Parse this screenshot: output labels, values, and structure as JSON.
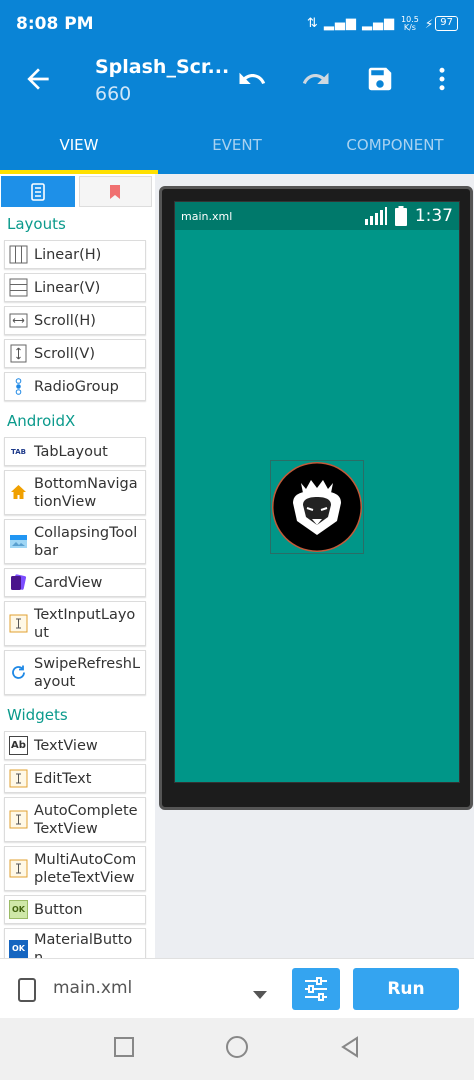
{
  "status": {
    "time": "8:08 PM",
    "speed_value": "10.5",
    "speed_unit": "K/s",
    "battery": "97"
  },
  "toolbar": {
    "title": "Splash_Scr...",
    "subtitle": "660"
  },
  "tabs": [
    {
      "label": "VIEW"
    },
    {
      "label": "EVENT"
    },
    {
      "label": "COMPONENT"
    }
  ],
  "palette": {
    "sections": [
      {
        "title": "Layouts",
        "items": [
          {
            "label": "Linear(H)"
          },
          {
            "label": "Linear(V)"
          },
          {
            "label": "Scroll(H)"
          },
          {
            "label": "Scroll(V)"
          },
          {
            "label": "RadioGroup"
          }
        ]
      },
      {
        "title": "AndroidX",
        "items": [
          {
            "label": "TabLayout"
          },
          {
            "label": "BottomNavigationView"
          },
          {
            "label": "CollapsingToolbar"
          },
          {
            "label": "CardView"
          },
          {
            "label": "TextInputLayout"
          },
          {
            "label": "SwipeRefreshLayout"
          }
        ]
      },
      {
        "title": "Widgets",
        "items": [
          {
            "label": "TextView"
          },
          {
            "label": "EditText"
          },
          {
            "label": "AutoCompleteTextView"
          },
          {
            "label": "MultiAutoCompleteTextView"
          },
          {
            "label": "Button"
          },
          {
            "label": "MaterialButton"
          }
        ]
      }
    ]
  },
  "preview": {
    "file": "main.xml",
    "time": "1:37"
  },
  "bottom": {
    "file": "main.xml",
    "run_label": "Run"
  },
  "icons": {
    "tab_icon": "TAB",
    "ok_icon": "OK",
    "ab_icon": "Ab"
  },
  "colors": {
    "accent": "#0a84d6",
    "screen": "#009688",
    "section": "#0b9a8c",
    "run": "#34a4f0",
    "indicator": "#ffe000"
  }
}
